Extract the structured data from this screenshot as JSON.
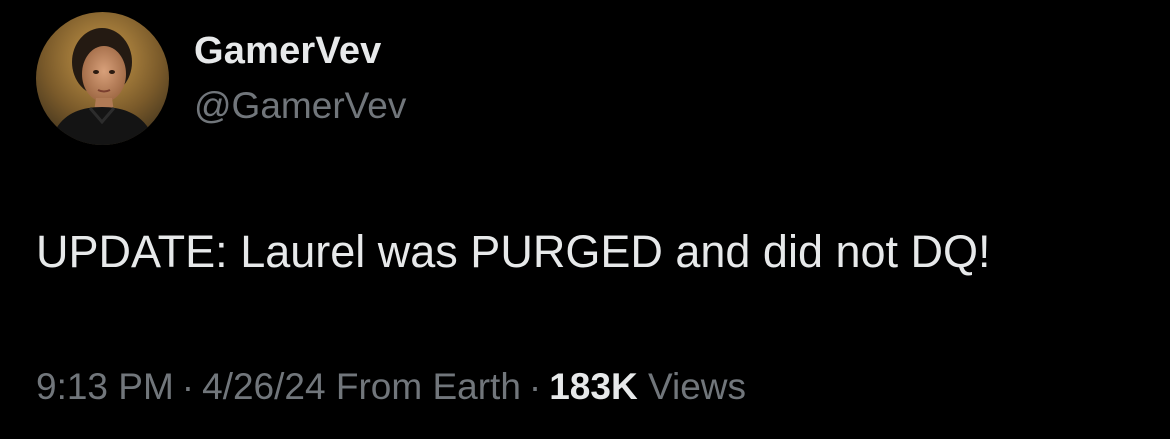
{
  "author": {
    "display_name": "GamerVev",
    "handle": "@GamerVev",
    "avatar_icon": "profile-photo"
  },
  "tweet": {
    "text": "UPDATE: Laurel was PURGED and did not DQ!"
  },
  "meta": {
    "time": "9:13 PM",
    "separator": "·",
    "date": "4/26/24",
    "source": "From Earth",
    "views_count": "183K",
    "views_label": "Views"
  },
  "colors": {
    "background": "#000000",
    "primary_text": "#e7e9ea",
    "secondary_text": "#71767b"
  }
}
